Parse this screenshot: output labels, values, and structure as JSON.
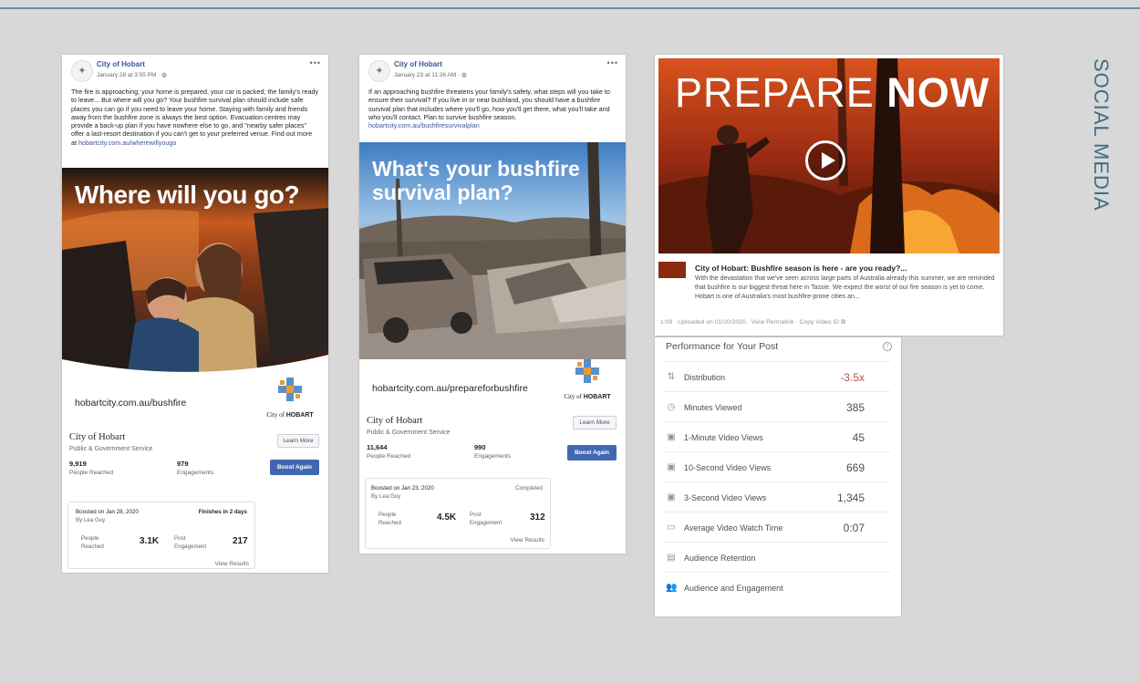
{
  "slide_title": "SOCIAL MEDIA",
  "post1": {
    "page": "City of Hobart",
    "date": "January 28 at 3:55 PM · ",
    "text": "The fire is approaching; your home is prepared, your car is packed; the family's ready to leave... But where will you go? Your bushfire survival plan should include safe places you can go if you need to leave your home. Staying with family and friends away from the bushfire zone is always the best option. Evacuation centres may provide a back-up plan if you have nowhere else to go, and \"nearby safer places\" offer a last-resort destination if you can't get to your preferred venue. Find out more at ",
    "text_link": "hobartcity.com.au/wherewillyougo",
    "image_headline": "Where will you go?",
    "url": "hobartcity.com.au/bushfire",
    "logo_word1": "City of",
    "logo_word2": "HOBART",
    "page_name": "City of Hobart",
    "category": "Public & Government Service",
    "learn_more": "Learn More",
    "reached": "9,919",
    "reached_label": "People Reached",
    "engagements": "979",
    "engagements_label": "Engagements",
    "boost_again": "Boost Again",
    "boosted_on": "Boosted on Jan 28, 2020",
    "by": "By Lea Guy",
    "status": "Finishes in 2 days",
    "people": "People",
    "reached_short": "Reached",
    "people_value": "3.1K",
    "post": "Post",
    "engagement": "Engagement",
    "post_value": "217",
    "view_results": "View Results"
  },
  "post2": {
    "page": "City of Hobart",
    "date": "January 23 at 11:26 AM · ",
    "text": "If an approaching bushfire threatens your family's safety, what steps will you take to ensure their survival? If you live in or near bushland, you should have a bushfire survival plan that includes where you'll go, how you'll get there, what you'll take and who you'll contact. Plan to survive bushfire season. ",
    "text_link": "hobartcity.com.au/bushfiresurvivalplan",
    "image_headline_1": "What's your bushfire",
    "image_headline_2": "survival plan?",
    "url": "hobartcity.com.au/prepareforbushfire",
    "logo_word1": "City of",
    "logo_word2": "HOBART",
    "page_name": "City of Hobart",
    "category": "Public & Government Service",
    "learn_more": "Learn More",
    "reached": "11,644",
    "reached_label": "People Reached",
    "engagements": "990",
    "engagements_label": "Engagements",
    "boost_again": "Boost Again",
    "boosted_on": "Boosted on Jan 23, 2020",
    "by": "By Lea Guy",
    "status": "Completed",
    "people": "People",
    "reached_short": "Reached",
    "people_value": "4.5K",
    "post": "Post",
    "engagement": "Engagement",
    "post_value": "312",
    "view_results": "View Results"
  },
  "video": {
    "headline_1": "PREPARE",
    "headline_2": "NOW",
    "title": "City of Hobart: Bushfire season is here - are you ready?...",
    "desc": "With the devastation that we've seen across large parts of Australia already this summer, we are reminded that bushfire is our biggest threat here in Tassie. We expect the worst of our fire season is yet to come. Hobart is one of Australia's most bushfire-prone cities an...",
    "meta": "1:09 · Uploaded on 01/20/2020 · View Permalink · Copy Video ID",
    "perf_title": "Performance for Your Post",
    "metrics": [
      {
        "icon": "distribution-icon",
        "glyph": "⇅",
        "label": "Distribution",
        "value": "-3.5x",
        "color": "#c0504d"
      },
      {
        "icon": "clock-icon",
        "glyph": "◷",
        "label": "Minutes Viewed",
        "value": "385",
        "color": "#4b4f56"
      },
      {
        "icon": "video-icon",
        "glyph": "▣",
        "label": "1-Minute Video Views",
        "value": "45",
        "color": "#4b4f56"
      },
      {
        "icon": "video-icon",
        "glyph": "▣",
        "label": "10-Second Video Views",
        "value": "669",
        "color": "#4b4f56"
      },
      {
        "icon": "video-icon",
        "glyph": "▣",
        "label": "3-Second Video Views",
        "value": "1,345",
        "color": "#4b4f56"
      },
      {
        "icon": "watch-time-icon",
        "glyph": "▭",
        "label": "Average Video Watch Time",
        "value": "0:07",
        "color": "#4b4f56"
      },
      {
        "icon": "retention-icon",
        "glyph": "▤",
        "label": "Audience Retention",
        "value": "",
        "color": "#4b4f56"
      },
      {
        "icon": "audience-icon",
        "glyph": "👥",
        "label": "Audience and Engagement",
        "value": "",
        "color": "#4b4f56"
      }
    ]
  }
}
